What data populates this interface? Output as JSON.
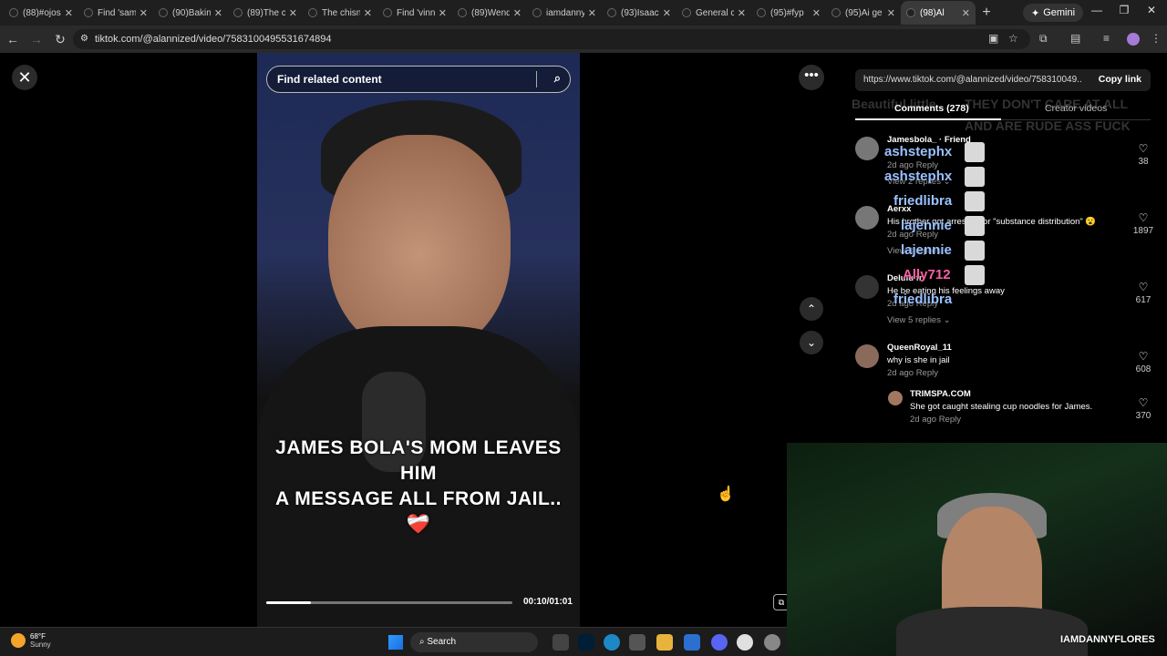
{
  "browser": {
    "tabs": [
      {
        "title": "(88)#ojos"
      },
      {
        "title": "Find 'sam"
      },
      {
        "title": "(90)Bakin"
      },
      {
        "title": "(89)The c"
      },
      {
        "title": "The chisn"
      },
      {
        "title": "Find 'vinn"
      },
      {
        "title": "(89)Wend"
      },
      {
        "title": "iamdanny"
      },
      {
        "title": "(93)Isaac"
      },
      {
        "title": "General c"
      },
      {
        "title": "(95)#fyp"
      },
      {
        "title": "(95)Ai ge"
      },
      {
        "title": "(98)Al",
        "active": true
      }
    ],
    "new_tab": "+",
    "gemini_label": "Gemini",
    "window_controls": {
      "minimize": "—",
      "maximize": "❐",
      "close": "✕"
    },
    "url": "tiktok.com/@alannized/video/7583100495531674894"
  },
  "video": {
    "search_placeholder": "Find related content",
    "caption_line1": "JAMES BOLA'S MOM LEAVES HIM",
    "caption_line2": "A MESSAGE ALL FROM JAIL.. ❤️‍🩹",
    "time": "00:10/01:01",
    "progress_fraction": 0.18
  },
  "panel": {
    "share_url": "https://www.tiktok.com/@alannized/video/758310049...",
    "copy_link": "Copy link",
    "tab_comments": "Comments (278)",
    "tab_creator": "Creator videos",
    "ghost_text_1": "Beautiful little",
    "ghost_text_2": "THEY DON'T CARE AT ALL",
    "ghost_text_3": "AND ARE RUDE ASS FUCK",
    "comments": [
      {
        "name": "Jamesbola_ · Friend",
        "text": "",
        "meta": "2d ago   Reply",
        "view_replies": "View 2 replies ⌄",
        "likes": "38"
      },
      {
        "name": "Aerxx",
        "text": "His brother got arrested for \"substance distribution\" 😮",
        "meta": "2d ago   Reply",
        "view_replies": "View 3 replies ⌄",
        "likes": "1897"
      },
      {
        "name": "Delulu fr",
        "text": "He be eating his feelings away",
        "meta": "2d ago   Reply",
        "view_replies": "View 5 replies ⌄",
        "likes": "617"
      },
      {
        "name": "QueenRoyal_11",
        "text": "why is she in jail",
        "meta": "2d ago   Reply",
        "view_replies": "",
        "likes": "608"
      },
      {
        "name": "TRIMSPA.COM",
        "text": "She got caught stealing cup noodles for James.",
        "meta": "2d ago   Reply",
        "view_replies": "",
        "likes": "370"
      }
    ]
  },
  "stream_overlay": {
    "names": [
      "ashstephx",
      "ashstephx",
      "friedlibra",
      "lajennie",
      "lajennie",
      "Ally712",
      "friedlibra"
    ],
    "handle": "IAMDANNYFLORES"
  },
  "taskbar": {
    "temp": "68°F",
    "weather": "Sunny",
    "search": "Search"
  },
  "icons": {
    "close": "✕",
    "more": "•••",
    "up": "⌃",
    "down": "⌄",
    "search": "⌕",
    "heart": "♡",
    "cursor": "☝"
  },
  "colors": {
    "overlay_blue": "#9bc0ff",
    "overlay_pink": "#ff5fa2"
  }
}
